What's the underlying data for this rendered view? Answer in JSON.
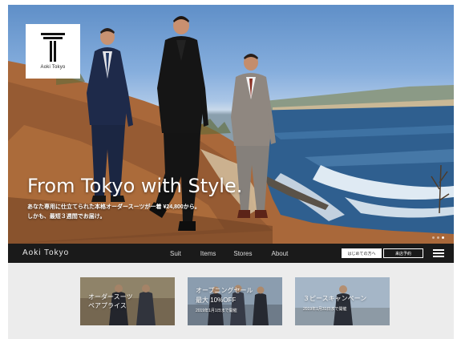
{
  "logo": {
    "text": "Aoki Tokyo"
  },
  "hero": {
    "headline": "From Tokyo with Style.",
    "subline_1": "あなた専用に仕立てられた本格オーダースーツが一着 ¥24,800から。",
    "subline_2": "しかも、最短３週間でお届け。",
    "slide_count": 3,
    "active_slide": 3
  },
  "nav": {
    "brand": "Aoki Tokyo",
    "links": [
      "Suit",
      "Items",
      "Stores",
      "About"
    ],
    "first_time_button": "はじめての方へ",
    "reserve_button": "来店予約"
  },
  "banners": [
    {
      "title_1": "オーダースーツ",
      "title_2": "ペアプライス",
      "note": ""
    },
    {
      "title_1": "オープニングセール",
      "title_2": "最大 10%OFF",
      "note": "2019年1月1日まで開催"
    },
    {
      "title_1": "３ピースキャンペーン",
      "title_2": "",
      "note": "2019年1月31日まで開催"
    }
  ],
  "colors": {
    "navbar": "#1a1a1a",
    "banner_area": "#ececec",
    "sea": "#2f5f8f"
  }
}
